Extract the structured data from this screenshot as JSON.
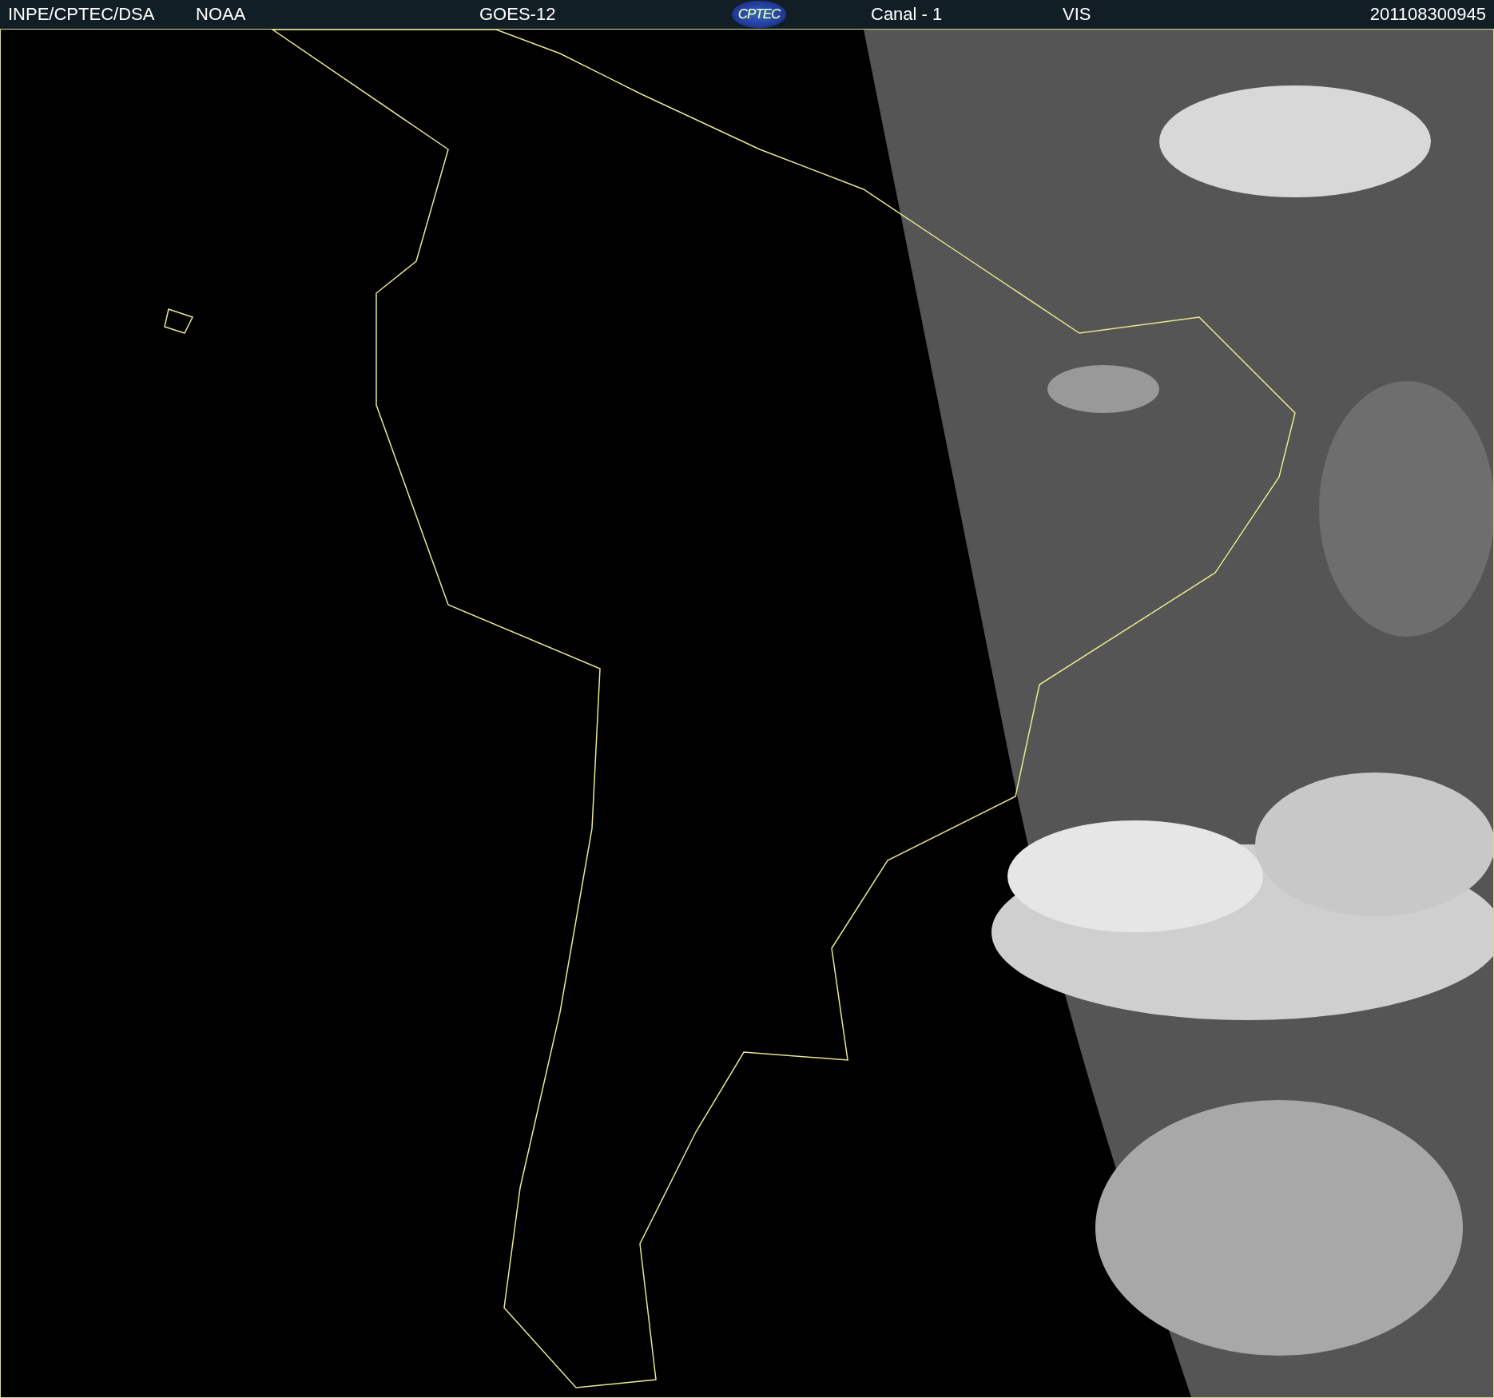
{
  "header": {
    "items": [
      {
        "kind": "text",
        "text": "INPE/CPTEC/DSA"
      },
      {
        "kind": "text",
        "text": "NOAA"
      },
      {
        "kind": "text",
        "text": "GOES-12"
      },
      {
        "kind": "logo",
        "text": "CPTEC"
      },
      {
        "kind": "text",
        "text": "Canal - 1"
      },
      {
        "kind": "text",
        "text": "VIS"
      },
      {
        "kind": "text",
        "text": "201108300945"
      }
    ]
  }
}
